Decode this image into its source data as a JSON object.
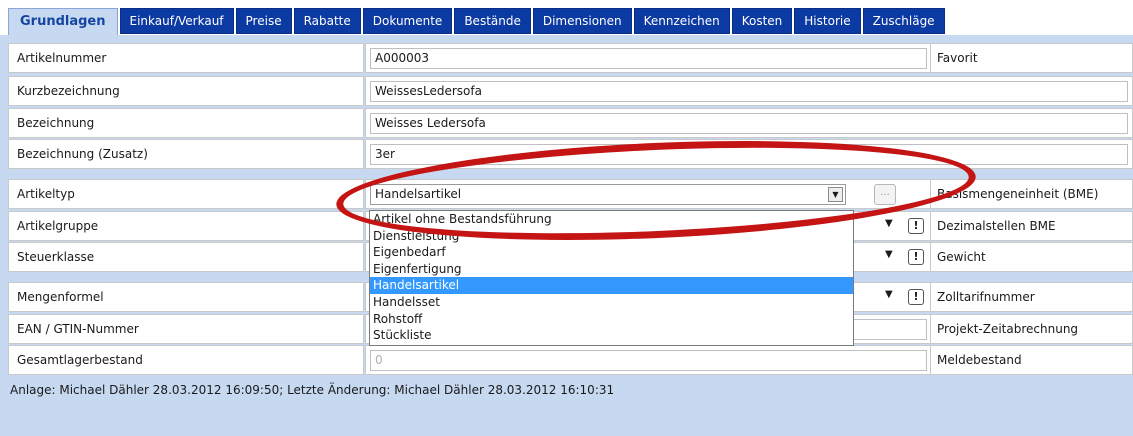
{
  "tabs": [
    {
      "label": "Grundlagen"
    },
    {
      "label": "Einkauf/Verkauf"
    },
    {
      "label": "Preise"
    },
    {
      "label": "Rabatte"
    },
    {
      "label": "Dokumente"
    },
    {
      "label": "Bestände"
    },
    {
      "label": "Dimensionen"
    },
    {
      "label": "Kennzeichen"
    },
    {
      "label": "Kosten"
    },
    {
      "label": "Historie"
    },
    {
      "label": "Zuschläge"
    }
  ],
  "fields": {
    "artikelnummer": {
      "label": "Artikelnummer",
      "value": "A000003",
      "right_label": "Favorit"
    },
    "kurzbezeichnung": {
      "label": "Kurzbezeichnung",
      "value": "WeissesLedersofa"
    },
    "bezeichnung": {
      "label": "Bezeichnung",
      "value": "Weisses Ledersofa"
    },
    "bezeichnung_zusatz": {
      "label": "Bezeichnung (Zusatz)",
      "value": "3er"
    },
    "artikeltyp": {
      "label": "Artikeltyp",
      "value": "Handelsartikel",
      "button": "...",
      "right_label": "Basismengeneinheit (BME)"
    },
    "artikelgruppe": {
      "label": "Artikelgruppe",
      "right_label": "Dezimalstellen BME"
    },
    "steuerklasse": {
      "label": "Steuerklasse",
      "right_label": "Gewicht"
    },
    "mengenformel": {
      "label": "Mengenformel",
      "right_label": "Zolltarifnummer"
    },
    "ean": {
      "label": "EAN / GTIN-Nummer",
      "right_label": "Projekt-Zeitabrechnung"
    },
    "gesamtlager": {
      "label": "Gesamtlagerbestand",
      "value": "0",
      "right_label": "Meldebestand"
    }
  },
  "dropdown_options": [
    "Artikel ohne Bestandsführung",
    "Dienstleistung",
    "Eigenbedarf",
    "Eigenfertigung",
    "Handelsartikel",
    "Handelsset",
    "Rohstoff",
    "Stückliste"
  ],
  "selected_option_index": 4,
  "status": "Anlage: Michael Dähler 28.03.2012 16:09:50; Letzte Änderung: Michael Dähler 28.03.2012 16:10:31",
  "colors": {
    "tab_bg": "#0c3aa3",
    "tab_active_bg": "#c7d9f1",
    "panel_bg": "#c7d9f1",
    "highlight": "#3399ff",
    "annotation": "#c41414"
  },
  "icons": {
    "dropdown_arrow": "chevron-down-icon",
    "info": "exclamation-icon"
  }
}
